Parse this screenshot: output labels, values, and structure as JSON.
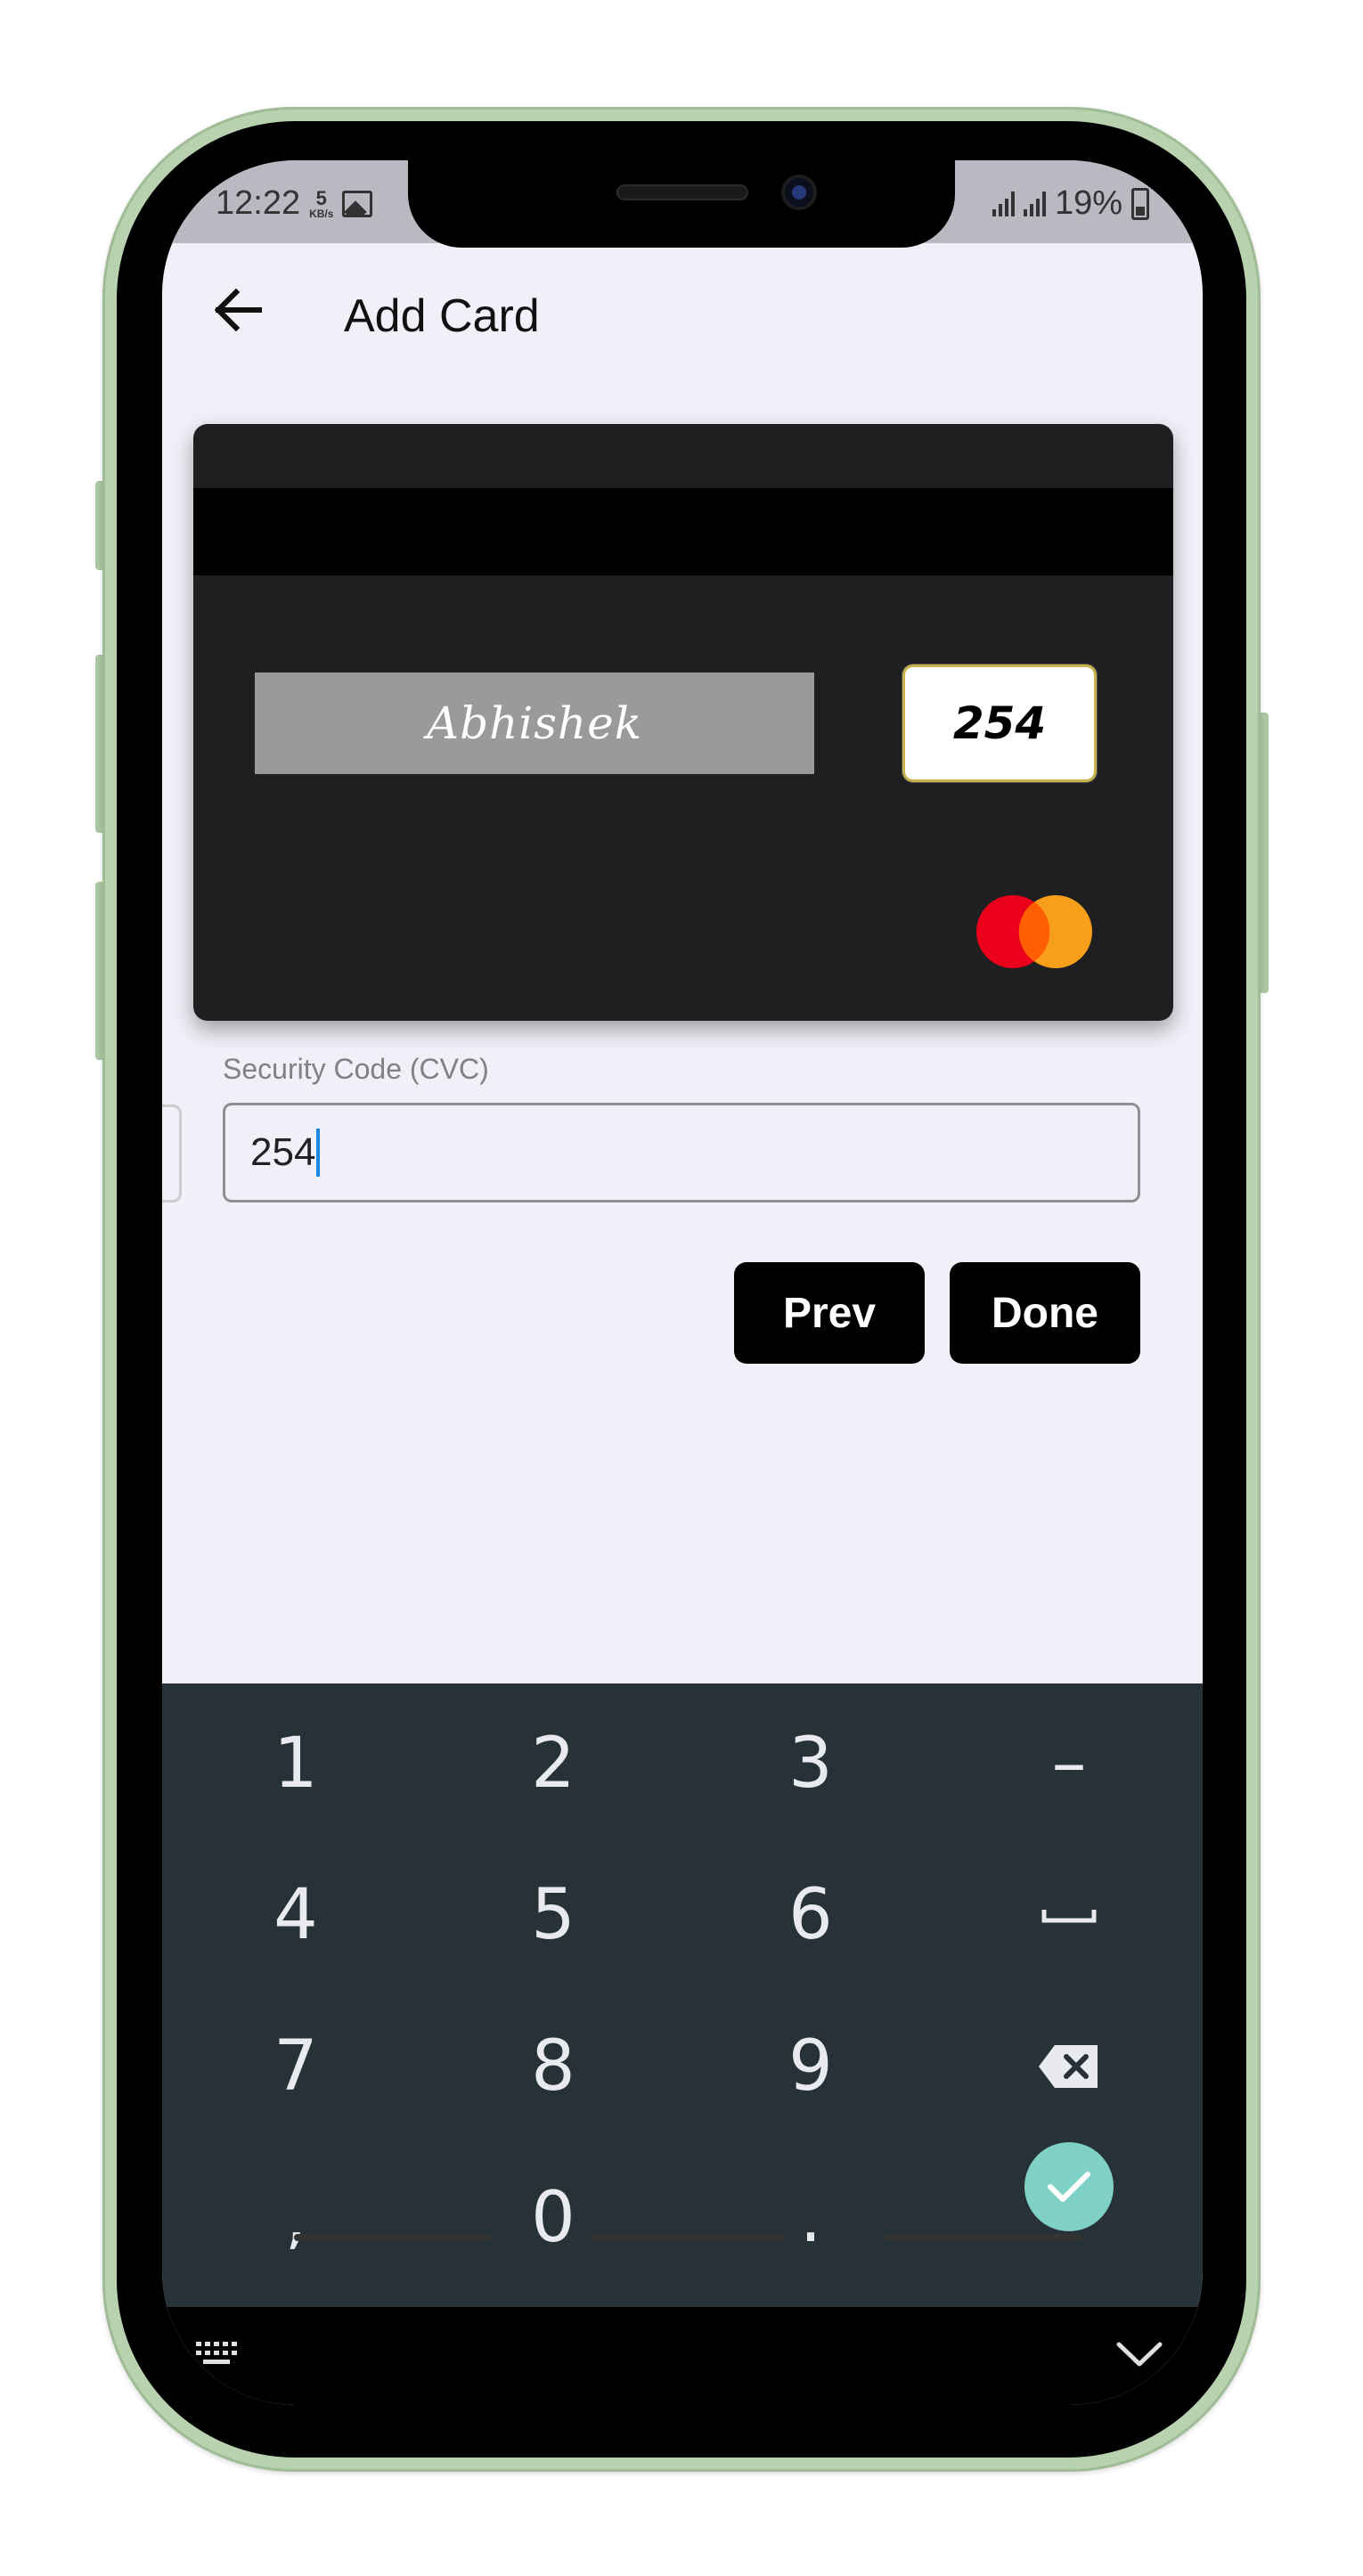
{
  "status_bar": {
    "time": "12:22",
    "net_speed_value": "5",
    "net_speed_unit": "KB/s",
    "battery": "19%"
  },
  "app_bar": {
    "title": "Add Card"
  },
  "card": {
    "signature": "Abhishek",
    "cvc": "254",
    "brand": "mastercard",
    "colors": {
      "mc_red": "#eb001b",
      "mc_orange": "#f79e1b",
      "card_bg": "#1f1f21"
    }
  },
  "form": {
    "cvc_label": "Security Code (CVC)",
    "cvc_value": "254"
  },
  "buttons": {
    "prev": "Prev",
    "done": "Done"
  },
  "keyboard": {
    "keys": [
      "1",
      "2",
      "3",
      "−",
      "4",
      "5",
      "6",
      "space",
      "7",
      "8",
      "9",
      "backspace",
      ",",
      "0",
      ".",
      "enter"
    ],
    "labels": {
      "k1": "1",
      "k2": "2",
      "k3": "3",
      "kminus": "–",
      "k4": "4",
      "k5": "5",
      "k6": "6",
      "k7": "7",
      "k8": "8",
      "k9": "9",
      "kcomma": ",",
      "k0": "0",
      "kdot": "."
    },
    "accent": "#7fd1c6"
  }
}
